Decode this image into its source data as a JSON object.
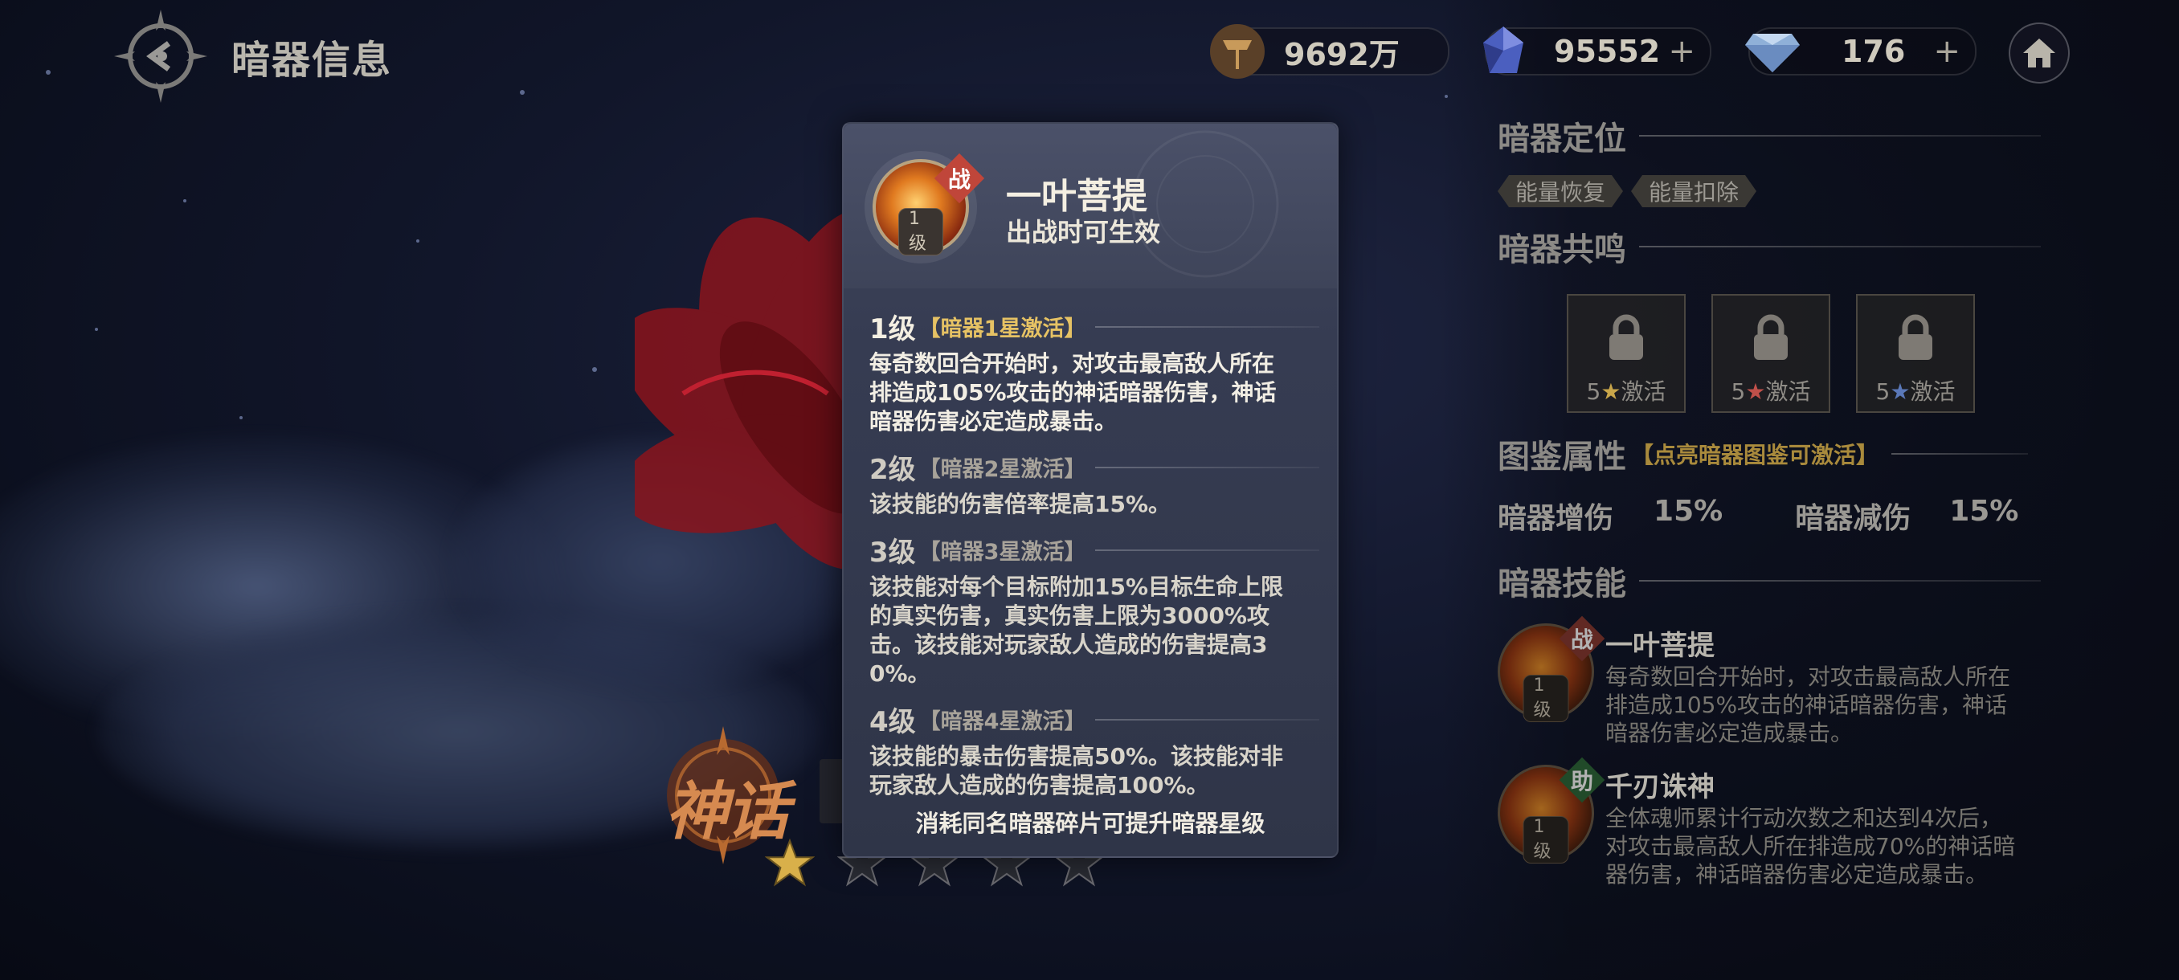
{
  "header": {
    "title": "暗器信息"
  },
  "resources": [
    {
      "icon": "gold-icon",
      "value": "9692万",
      "has_plus": false
    },
    {
      "icon": "crystal-icon",
      "value": "95552",
      "has_plus": true
    },
    {
      "icon": "diamond-icon",
      "value": "176",
      "has_plus": true
    }
  ],
  "home_icon": "home-icon",
  "popup": {
    "skill_name": "一叶菩提",
    "skill_subtitle": "出战时可生效",
    "badge": "战",
    "level_chip": "1级",
    "levels": [
      {
        "level": "1级",
        "condition": "【暗器1星激活】",
        "text_lines": [
          "每奇数回合开始时，对攻击最高敌人所在",
          "排造成105%攻击的神话暗器伤害，神话",
          "暗器伤害必定造成暴击。"
        ],
        "active": true
      },
      {
        "level": "2级",
        "condition": "【暗器2星激活】",
        "text_lines": [
          "该技能的伤害倍率提高15%。"
        ],
        "active": false
      },
      {
        "level": "3级",
        "condition": "【暗器3星激活】",
        "text_lines": [
          "该技能对每个目标附加15%目标生命上限",
          "的真实伤害，真实伤害上限为3000%攻",
          "击。该技能对玩家敌人造成的伤害提高3",
          "0%。"
        ],
        "active": false
      },
      {
        "level": "4级",
        "condition": "【暗器4星激活】",
        "text_lines": [
          "该技能的暴击伤害提高50%。该技能对非",
          "玩家敌人造成的伤害提高100%。"
        ],
        "active": false
      }
    ],
    "footer": "消耗同名暗器碎片可提升暗器星级"
  },
  "rarity_label": "神话",
  "stars": {
    "filled": 1,
    "total": 5
  },
  "right_panel": {
    "positioning": {
      "title": "暗器定位",
      "tags": [
        "能量恢复",
        "能量扣除"
      ]
    },
    "resonance": {
      "title": "暗器共鸣",
      "slots": [
        {
          "stars": "5",
          "label": "激活",
          "star_color": "#c9a64a"
        },
        {
          "stars": "5",
          "label": "激活",
          "star_color": "#c0504a"
        },
        {
          "stars": "5",
          "label": "激活",
          "star_color": "#5a78b8"
        }
      ]
    },
    "codex": {
      "title": "图鉴属性",
      "hint": "【点亮暗器图鉴可激活】",
      "stats": [
        {
          "label": "暗器增伤",
          "value": "15%"
        },
        {
          "label": "暗器减伤",
          "value": "15%"
        }
      ]
    },
    "skills": {
      "title": "暗器技能",
      "items": [
        {
          "name": "一叶菩提",
          "badge": "战",
          "badge_color": "#b0453a",
          "level": "1级",
          "desc_lines": [
            "每奇数回合开始时，对攻击最高敌人所在",
            "排造成105%攻击的神话暗器伤害，神话",
            "暗器伤害必定造成暴击。"
          ]
        },
        {
          "name": "千刃诛神",
          "badge": "助",
          "badge_color": "#3a8a4a",
          "level": "1级",
          "desc_lines": [
            "全体魂师累计行动次数之和达到4次后，",
            "对攻击最高敌人所在排造成70%的神话暗",
            "器伤害，神话暗器伤害必定造成暴击。"
          ]
        }
      ]
    }
  },
  "colors": {
    "accent_gold": "#e6c264",
    "condition_active": "#e6c264",
    "condition_dim": "#a8a39a"
  }
}
